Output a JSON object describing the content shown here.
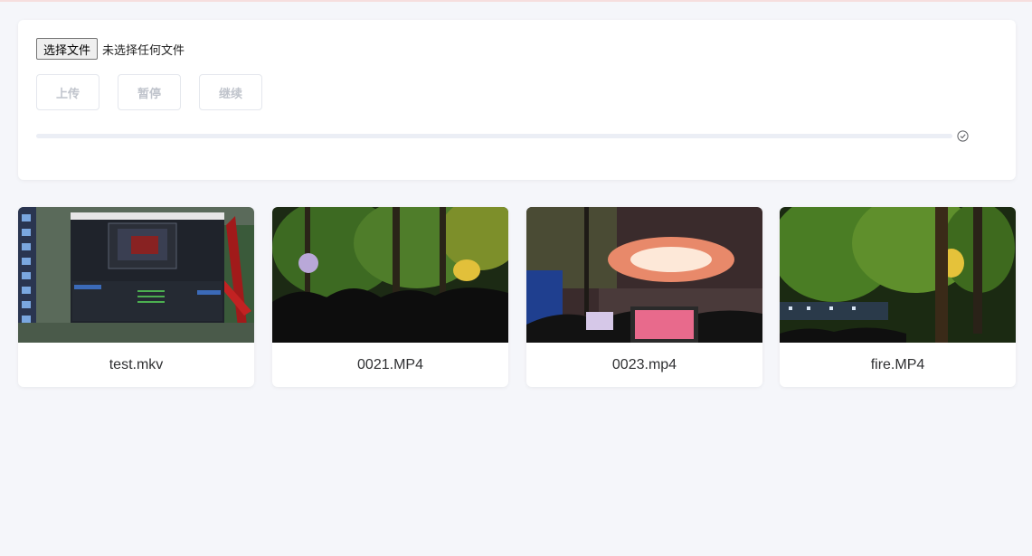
{
  "file_picker": {
    "button_label": "选择文件",
    "status_text": "未选择任何文件"
  },
  "controls": {
    "upload_label": "上传",
    "pause_label": "暂停",
    "resume_label": "继续"
  },
  "progress": {
    "percent": 0,
    "status_icon": "check-circle-icon"
  },
  "videos": [
    {
      "name": "test.mkv",
      "thumbnail": "desktop-screenshot-thumbnail"
    },
    {
      "name": "0021.MP4",
      "thumbnail": "night-trees-crowd-thumbnail"
    },
    {
      "name": "0023.mp4",
      "thumbnail": "fireworks-thumbnail"
    },
    {
      "name": "fire.MP4",
      "thumbnail": "lit-trees-thumbnail"
    }
  ],
  "colors": {
    "page_bg": "#f5f6fa",
    "card_bg": "#ffffff",
    "disabled_text": "#c0c4cc",
    "progress_track": "#ebeef5"
  }
}
